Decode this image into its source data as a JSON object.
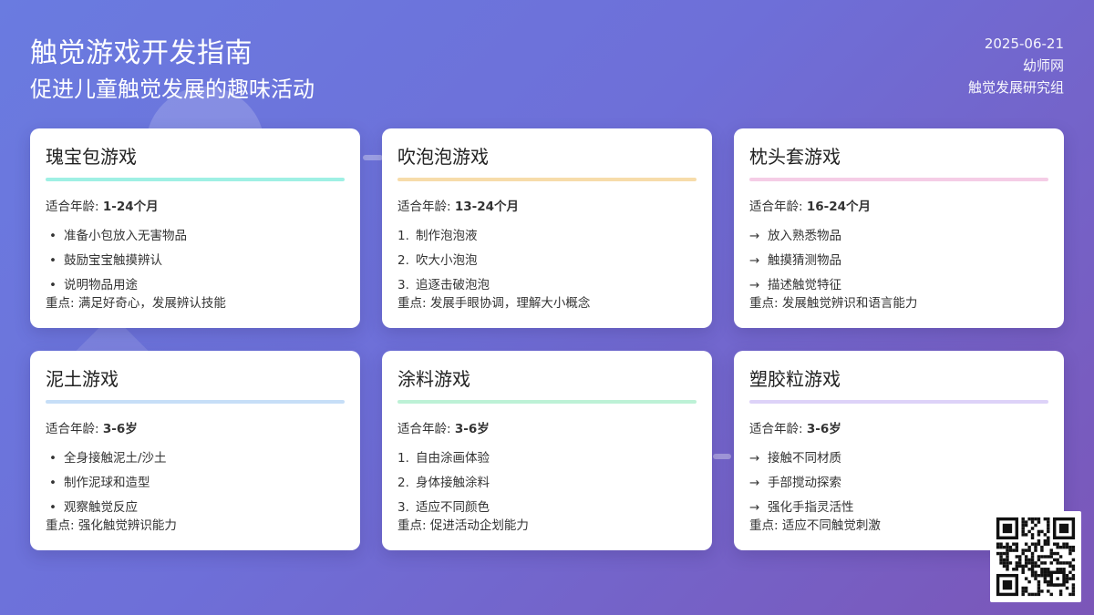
{
  "header": {
    "title": "触觉游戏开发指南",
    "subtitle": "促进儿童触觉发展的趣味活动",
    "date": "2025-06-21",
    "site": "幼师网",
    "group": "触觉发展研究组"
  },
  "cards": [
    {
      "title": "瑰宝包游戏",
      "accent": "#9ff0e4",
      "age_label": "适合年龄: ",
      "age_value": "1-24个月",
      "list_style": "bullet",
      "items": [
        "准备小包放入无害物品",
        "鼓励宝宝触摸辨认",
        "说明物品用途"
      ],
      "focus": "重点: 满足好奇心，发展辨认技能"
    },
    {
      "title": "吹泡泡游戏",
      "accent": "#f7dcaa",
      "age_label": "适合年龄: ",
      "age_value": "13-24个月",
      "list_style": "number",
      "items": [
        "制作泡泡液",
        "吹大小泡泡",
        "追逐击破泡泡"
      ],
      "focus": "重点: 发展手眼协调，理解大小概念"
    },
    {
      "title": "枕头套游戏",
      "accent": "#f5cde6",
      "age_label": "适合年龄: ",
      "age_value": "16-24个月",
      "list_style": "arrow",
      "items": [
        "放入熟悉物品",
        "触摸猜测物品",
        "描述触觉特征"
      ],
      "focus": "重点: 发展触觉辨识和语言能力"
    },
    {
      "title": "泥土游戏",
      "accent": "#c6def7",
      "age_label": "适合年龄: ",
      "age_value": "3-6岁",
      "list_style": "bullet",
      "items": [
        "全身接触泥土/沙土",
        "制作泥球和造型",
        "观察触觉反应"
      ],
      "focus": "重点: 强化触觉辨识能力"
    },
    {
      "title": "涂料游戏",
      "accent": "#bdf1d6",
      "age_label": "适合年龄: ",
      "age_value": "3-6岁",
      "list_style": "number",
      "items": [
        "自由涂画体验",
        "身体接触涂料",
        "适应不同颜色"
      ],
      "focus": "重点: 促进活动企划能力"
    },
    {
      "title": "塑胶粒游戏",
      "accent": "#ddd2f8",
      "age_label": "适合年龄: ",
      "age_value": "3-6岁",
      "list_style": "arrow",
      "items": [
        "接触不同材质",
        "手部搅动探索",
        "强化手指灵活性"
      ],
      "focus": "重点: 适应不同触觉刺激"
    }
  ],
  "qr_code": {
    "icon": "qr-code-icon"
  }
}
